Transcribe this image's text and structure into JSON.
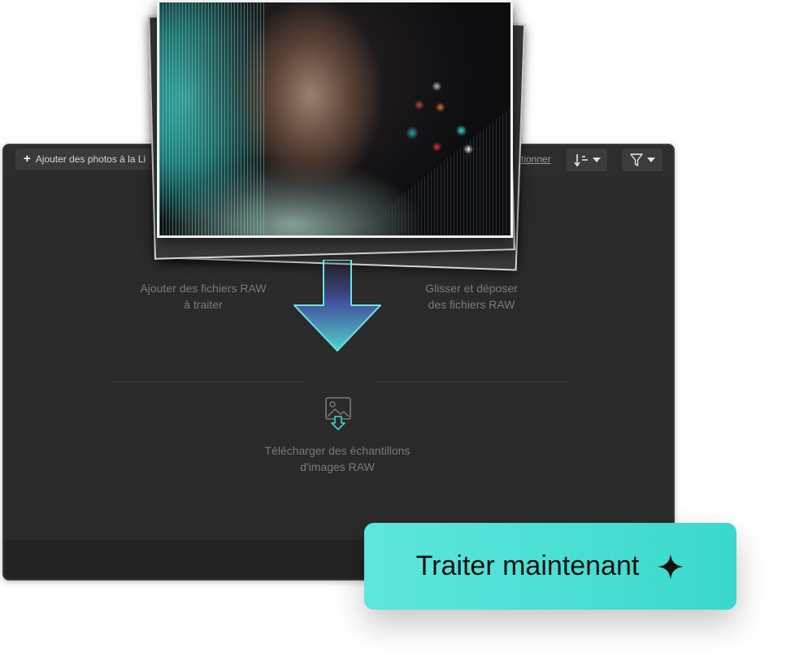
{
  "toolbar": {
    "add_label": "Ajouter des photos à la Li",
    "select_link": "ctionner",
    "sort_icon": "sort-icon",
    "filter_icon": "filter-icon"
  },
  "main": {
    "add_raw_line1": "Ajouter des fichiers RAW",
    "add_raw_line2": "à traiter",
    "drag_drop_line1": "Glisser et déposer",
    "drag_drop_line2": "des fichiers RAW",
    "download_line1": "Télécharger des échantillons",
    "download_line2": "d'images RAW"
  },
  "cta": {
    "label": "Traiter maintenant",
    "icon": "sparkle-icon"
  },
  "colors": {
    "accent": "#3bd8cc",
    "window_bg": "#2b2b2b",
    "text_muted": "#7a7a7a"
  }
}
